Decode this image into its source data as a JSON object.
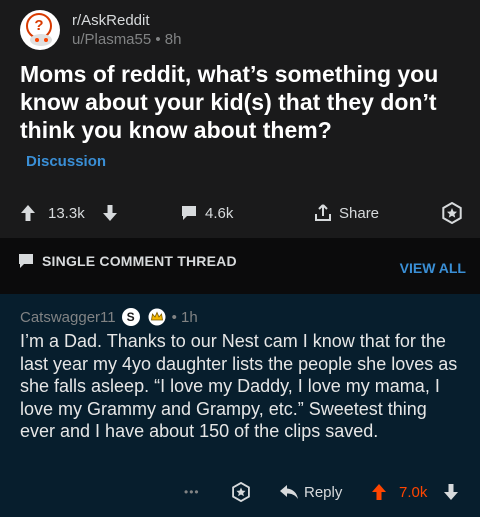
{
  "post": {
    "subreddit": "r/AskReddit",
    "author_line": "u/Plasma55 • 8h",
    "title": "Moms of reddit, what’s something you know about your kid(s) that they don’t think you know about them?",
    "flair": "Discussion",
    "upvotes": "13.3k",
    "comments": "4.6k",
    "share_label": "Share"
  },
  "thread": {
    "label": "SINGLE COMMENT THREAD",
    "view_all": "VIEW ALL"
  },
  "comment": {
    "author": "Catswagger11",
    "badge_letter": "S",
    "time": "• 1h",
    "body": "I’m a Dad. Thanks to our Nest cam I know that for the last year my 4yo daughter lists the people she loves as she falls asleep. “I love my Daddy, I love my mama, I love my Grammy and Grampy, etc.” Sweetest thing ever and I have about 150 of the clips saved.",
    "more": "•••",
    "reply_label": "Reply",
    "score": "7.0k"
  },
  "colors": {
    "background": "#1a1a1b",
    "comment_bg": "#071e2d",
    "accent_blue": "#3a8fd6",
    "upvote_orange": "#ff4500"
  }
}
